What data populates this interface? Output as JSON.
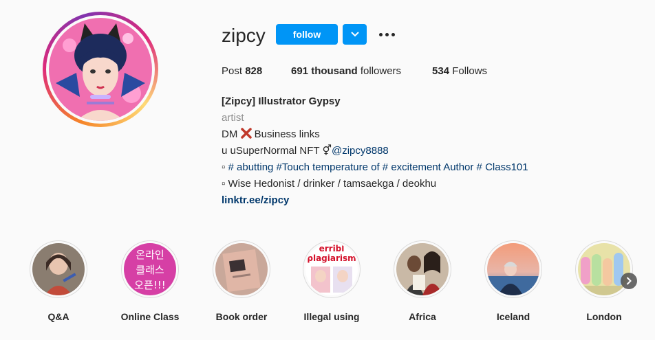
{
  "profile": {
    "username": "zipcy",
    "follow_label": "follow",
    "avatar_icon": "profile-avatar-illustration"
  },
  "stats": {
    "posts_label": "Post",
    "posts_count": "828",
    "followers_count": "691 thousand",
    "followers_label": "followers",
    "following_count": "534",
    "following_label": "Follows"
  },
  "bio": {
    "name": "[Zipcy] Illustrator Gypsy",
    "category": "artist",
    "line1_text": "DM",
    "line1_icon": "cross-mark-icon",
    "line1_suffix": "Business links",
    "line2_text": "u uSuperNormal NFT ⚥",
    "line2_mention": "@zipcy8888",
    "line3_prefix": "▫",
    "line3_tags": "# abutting #Touch temperature of # excitement Author # Class101",
    "line4": "▫ Wise Hedonist / drinker / tamsaekga / deokhu",
    "link": "linktr.ee/zipcy"
  },
  "highlights": [
    {
      "label": "Q&A",
      "icon": "qa-highlight"
    },
    {
      "label": "Online Class",
      "icon": "online-class-highlight",
      "text": [
        "온라인",
        "클래스",
        "오픈!!!"
      ]
    },
    {
      "label": "Book order",
      "icon": "book-order-highlight"
    },
    {
      "label": "Illegal using",
      "icon": "illegal-using-highlight",
      "text": [
        "erribl",
        "plagiarism"
      ]
    },
    {
      "label": "Africa",
      "icon": "africa-highlight"
    },
    {
      "label": "Iceland",
      "icon": "iceland-highlight"
    },
    {
      "label": "London",
      "icon": "london-highlight"
    }
  ],
  "colors": {
    "accent": "#0095f6",
    "link": "#00376b",
    "muted": "#8e8e8e",
    "text": "#262626",
    "background": "#fafafa"
  }
}
